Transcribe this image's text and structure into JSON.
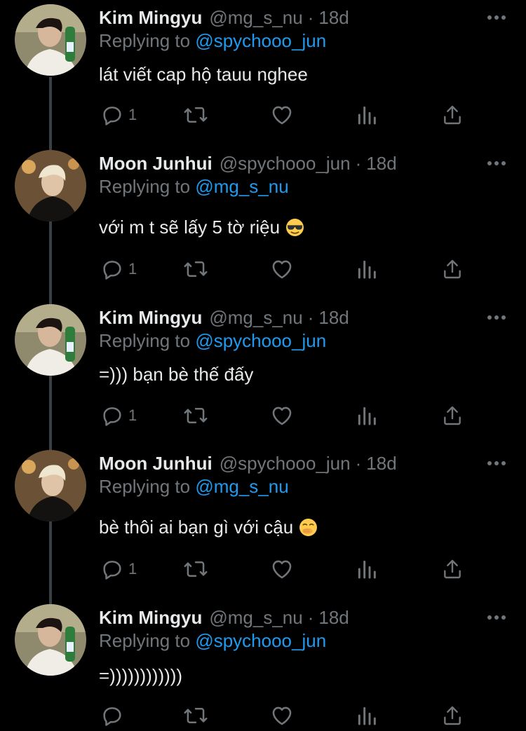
{
  "colors": {
    "background": "#000000",
    "text": "#e7e9ea",
    "muted": "#71767b",
    "link": "#1d9bf0",
    "thread_line": "#3a3f44"
  },
  "labels": {
    "replying_to": "Replying to",
    "dot": "·"
  },
  "icons": [
    "reply-icon",
    "retweet-icon",
    "like-icon",
    "analytics-icon",
    "share-icon",
    "more-icon",
    "sunglasses-emoji",
    "face-with-hand-over-mouth-emoji"
  ],
  "tweets": [
    {
      "name": "Kim Mingyu",
      "handle": "@mg_s_nu",
      "time": "18d",
      "reply_to": "@spychooo_jun",
      "text": "lát viết cap hộ tauu nghee",
      "reply_count": "1"
    },
    {
      "name": "Moon Junhui",
      "handle": "@spychooo_jun",
      "time": "18d",
      "reply_to": "@mg_s_nu",
      "text": "với m t sẽ lấy 5 tờ riệu",
      "emoji": "sunglasses-emoji",
      "reply_count": "1"
    },
    {
      "name": "Kim Mingyu",
      "handle": "@mg_s_nu",
      "time": "18d",
      "reply_to": "@spychooo_jun",
      "text": "=))) bạn bè thế đấy",
      "reply_count": "1"
    },
    {
      "name": "Moon Junhui",
      "handle": "@spychooo_jun",
      "time": "18d",
      "reply_to": "@mg_s_nu",
      "text": "bè thôi ai bạn gì với cậu",
      "emoji": "face-with-hand-over-mouth-emoji",
      "reply_count": "1"
    },
    {
      "name": "Kim Mingyu",
      "handle": "@mg_s_nu",
      "time": "18d",
      "reply_to": "@spychooo_jun",
      "text": "=))))))))))))",
      "reply_count": ""
    }
  ]
}
